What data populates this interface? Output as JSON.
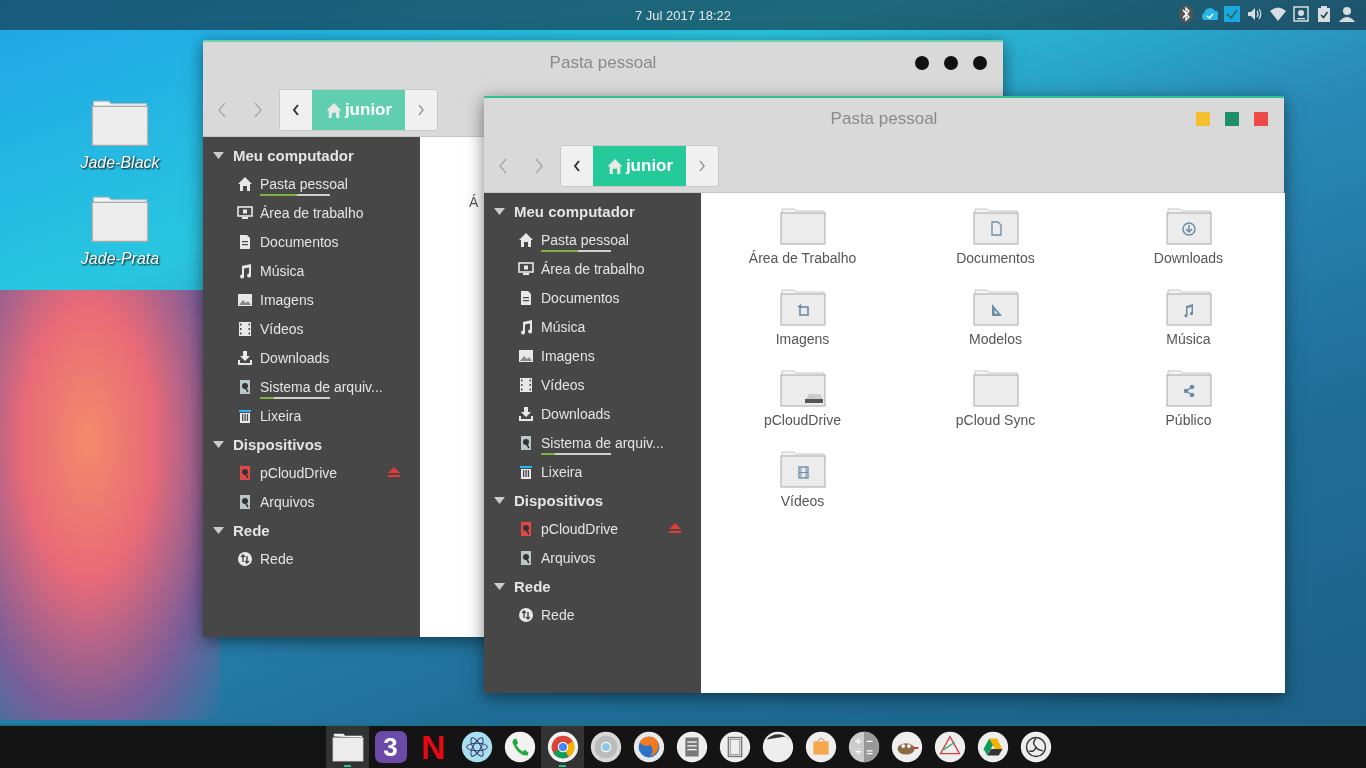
{
  "top_bar": {
    "clock": "7 Jul 2017 18:22",
    "tray": [
      {
        "kind": "bluetooth"
      },
      {
        "kind": "cloud"
      },
      {
        "kind": "check"
      },
      {
        "kind": "volume"
      },
      {
        "kind": "wifi"
      },
      {
        "kind": "display"
      },
      {
        "kind": "clipboard"
      },
      {
        "kind": "user"
      }
    ]
  },
  "desktop_icons": [
    {
      "label": "Jade-Black"
    },
    {
      "label": "Jade-Prata"
    }
  ],
  "windows": [
    {
      "title": "Pasta pessoal",
      "active": false,
      "path": "junior",
      "sidebar": [
        {
          "title": "Meu computador",
          "expanded": true,
          "items": [
            {
              "label": "Pasta pessoal",
              "kind": "home",
              "level": 0.53
            },
            {
              "label": "Área de trabalho",
              "kind": "desktop"
            },
            {
              "label": "Documentos",
              "kind": "document"
            },
            {
              "label": "Música",
              "kind": "music"
            },
            {
              "label": "Imagens",
              "kind": "image"
            },
            {
              "label": "Vídeos",
              "kind": "video"
            },
            {
              "label": "Downloads",
              "kind": "download"
            },
            {
              "label": "Sistema de arquiv...",
              "kind": "drive",
              "level": 0.2
            },
            {
              "label": "Lixeira",
              "kind": "trash"
            }
          ]
        },
        {
          "title": "Dispositivos",
          "expanded": true,
          "items": [
            {
              "label": "pCloudDrive",
              "kind": "drive-red",
              "ejectable": true
            },
            {
              "label": "Arquivos",
              "kind": "drive",
              "ejectable": false
            }
          ]
        },
        {
          "title": "Rede",
          "expanded": true,
          "items": [
            {
              "label": "Rede",
              "kind": "network"
            }
          ]
        }
      ],
      "files": [
        {
          "label": "Á"
        }
      ]
    },
    {
      "title": "Pasta pessoal",
      "active": true,
      "path": "junior",
      "sidebar": [
        {
          "title": "Meu computador",
          "expanded": true,
          "items": [
            {
              "label": "Pasta pessoal",
              "kind": "home",
              "level": 0.53
            },
            {
              "label": "Área de trabalho",
              "kind": "desktop"
            },
            {
              "label": "Documentos",
              "kind": "document"
            },
            {
              "label": "Música",
              "kind": "music"
            },
            {
              "label": "Imagens",
              "kind": "image"
            },
            {
              "label": "Vídeos",
              "kind": "video"
            },
            {
              "label": "Downloads",
              "kind": "download"
            },
            {
              "label": "Sistema de arquiv...",
              "kind": "drive",
              "level": 0.2
            },
            {
              "label": "Lixeira",
              "kind": "trash"
            }
          ]
        },
        {
          "title": "Dispositivos",
          "expanded": true,
          "items": [
            {
              "label": "pCloudDrive",
              "kind": "drive-red",
              "ejectable": true
            },
            {
              "label": "Arquivos",
              "kind": "drive",
              "ejectable": false
            }
          ]
        },
        {
          "title": "Rede",
          "expanded": true,
          "items": [
            {
              "label": "Rede",
              "kind": "network"
            }
          ]
        }
      ],
      "files": [
        {
          "label": "Área de Trabalho",
          "kind": "plain"
        },
        {
          "label": "Documentos",
          "kind": "document"
        },
        {
          "label": "Downloads",
          "kind": "download"
        },
        {
          "label": "Imagens",
          "kind": "image"
        },
        {
          "label": "Modelos",
          "kind": "template"
        },
        {
          "label": "Música",
          "kind": "music"
        },
        {
          "label": "pCloudDrive",
          "kind": "drive"
        },
        {
          "label": "pCloud Sync",
          "kind": "plain"
        },
        {
          "label": "Público",
          "kind": "share"
        },
        {
          "label": "Vídeos",
          "kind": "video"
        }
      ]
    }
  ],
  "dock": [
    {
      "kind": "files",
      "running": true
    },
    {
      "kind": "purple",
      "glyph": "3",
      "running": false
    },
    {
      "kind": "red",
      "glyph": "N",
      "running": false
    },
    {
      "kind": "atom",
      "running": false
    },
    {
      "kind": "phone",
      "running": false
    },
    {
      "kind": "chrome",
      "running": true
    },
    {
      "kind": "chromium",
      "running": false
    },
    {
      "kind": "firefox",
      "running": false
    },
    {
      "kind": "text",
      "running": false
    },
    {
      "kind": "notes",
      "running": false
    },
    {
      "kind": "disk",
      "running": false
    },
    {
      "kind": "store",
      "running": false
    },
    {
      "kind": "calc",
      "running": false
    },
    {
      "kind": "gimp",
      "running": false
    },
    {
      "kind": "inkscape",
      "running": false
    },
    {
      "kind": "drive",
      "running": false
    },
    {
      "kind": "obs",
      "running": false
    }
  ]
}
